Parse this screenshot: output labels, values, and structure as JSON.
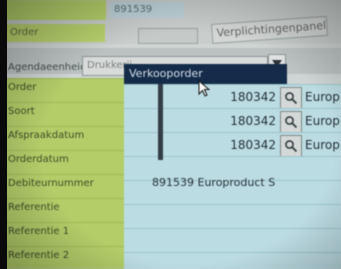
{
  "header": {
    "top_value": "891539",
    "fragment_label": "Order",
    "tab_label": "Verplichtingenpanel"
  },
  "field": {
    "label": "Agendaeenheid:",
    "select_value": "Drukkerij"
  },
  "dropdown": {
    "highlighted": "Verkooporder"
  },
  "labels": [
    "Order",
    "Soort",
    "Afspraakdatum",
    "Orderdatum",
    "Debiteurnummer",
    "Referentie",
    "Referentie 1",
    "Referentie 2"
  ],
  "rows": [
    {
      "number": "180342",
      "desc": "Europroduct"
    },
    {
      "number": "180342",
      "desc": "Europroduct"
    },
    {
      "number": "180342",
      "desc": "Europroduct"
    }
  ],
  "product_line": "891539 Europroduct S"
}
